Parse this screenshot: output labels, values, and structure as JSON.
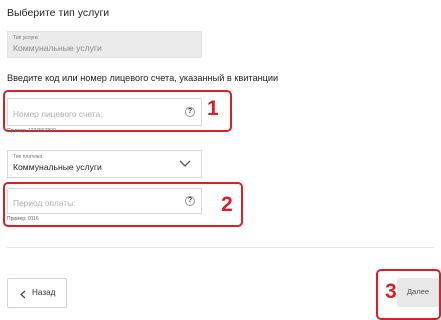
{
  "service_section": {
    "title": "Выберите тип услуги",
    "field_label": "Тип услуги",
    "field_value": "Коммунальные услуги"
  },
  "account_section": {
    "title": "Введите код или номер лицевого счета, указанный в квитанции",
    "account_placeholder": "Номер лицевого счета:",
    "account_hint": "Пример: 1234567890",
    "help_symbol": "?",
    "payment_type_label": "Тип платежа",
    "payment_type_value": "Коммунальные услуги",
    "period_placeholder": "Период оплаты:",
    "period_hint": "Пример: 0116"
  },
  "annotations": {
    "one": "1",
    "two": "2",
    "three": "3"
  },
  "footer": {
    "back_label": "Назад",
    "next_label": "Далее"
  },
  "colors": {
    "annotation_red": "#d8202a",
    "readonly_bg": "#ebebeb",
    "next_bg": "#e8e8e8"
  },
  "icons": [
    "chevron-left-icon",
    "chevron-down-icon",
    "help-icon"
  ]
}
